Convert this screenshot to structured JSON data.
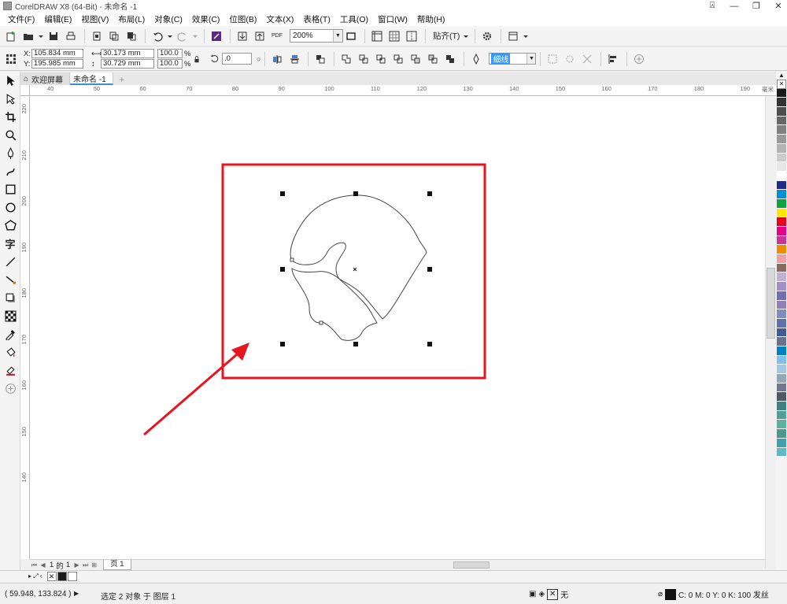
{
  "window": {
    "title": "CorelDRAW X8 (64-Bit) - 未命名 -1"
  },
  "menu": [
    "文件(F)",
    "编辑(E)",
    "视图(V)",
    "布局(L)",
    "对象(C)",
    "效果(C)",
    "位图(B)",
    "文本(X)",
    "表格(T)",
    "工具(O)",
    "窗口(W)",
    "帮助(H)"
  ],
  "toolbar": {
    "zoom": "200%",
    "snap": "贴齐(T)",
    "pdf_label": "PDF"
  },
  "props": {
    "x_label": "X:",
    "x": "105.834 mm",
    "y_label": "Y:",
    "y": "195.985 mm",
    "w": "30.173 mm",
    "h": "30.729 mm",
    "sx": "100.0",
    "sy": "100.0",
    "pct": "%",
    "rotation": ".0",
    "line_width": "细线"
  },
  "tabs": {
    "welcome": "欢迎屏幕",
    "doc": "未命名 -1"
  },
  "rulers": {
    "top": [
      "40",
      "50",
      "60",
      "70",
      "80",
      "90",
      "100",
      "110",
      "120",
      "130",
      "140",
      "150",
      "160",
      "170",
      "180",
      "190"
    ],
    "top_unit": "毫米",
    "left": [
      "220",
      "210",
      "200",
      "190",
      "180",
      "170",
      "160",
      "150",
      "140"
    ]
  },
  "pagenav": {
    "current": "1",
    "of": "的",
    "total": "1",
    "page_tab": "页 1"
  },
  "status": {
    "coords": "( 59.948, 133.824 )",
    "selection": "选定 2 对象 于 图层 1",
    "fill": "无",
    "outline": "C: 0 M: 0 Y: 0 K: 100  发丝"
  },
  "palette_colors": [
    "#1a1a1a",
    "#333333",
    "#4d4d4d",
    "#666666",
    "#808080",
    "#999999",
    "#b3b3b3",
    "#cccccc",
    "#e6e6e6",
    "#ffffff",
    "#1e2b8a",
    "#0090d8",
    "#10a040",
    "#ffe600",
    "#e6001e",
    "#e6008a",
    "#cc3399",
    "#f08c00",
    "#f0a0a0",
    "#8a6a5a",
    "#c0b0d8",
    "#a090c8",
    "#7070b0",
    "#9080b8",
    "#808cc0",
    "#6070a8",
    "#405a98",
    "#6a7090",
    "#0080c0",
    "#80c0e8",
    "#a0c8e0",
    "#90a8b8",
    "#707890",
    "#505868",
    "#408080",
    "#50a098",
    "#60b0a0",
    "#4a9a8a",
    "#40a0b0",
    "#60b8c8"
  ],
  "doc_colors": [
    "#1a1a1a",
    "#ffffff"
  ],
  "annotation_color": "#e8141e"
}
